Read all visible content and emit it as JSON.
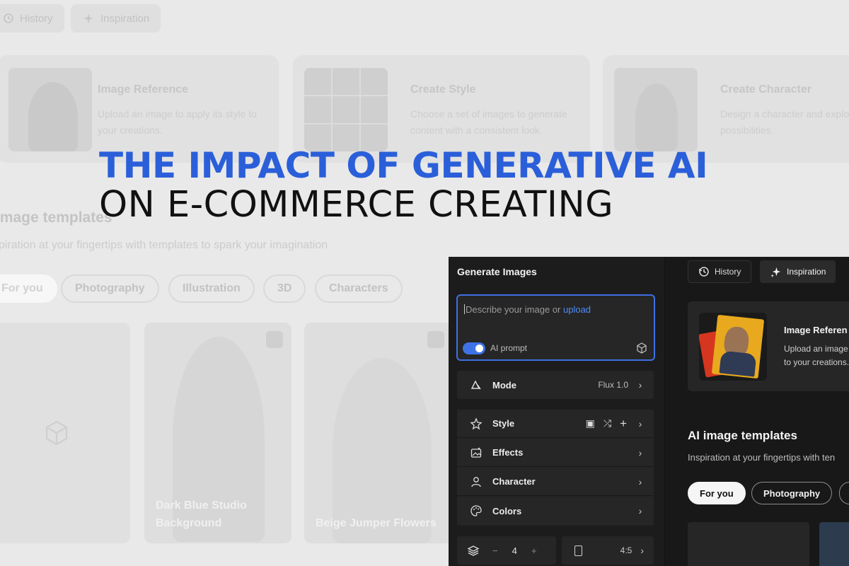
{
  "background": {
    "top_buttons": [
      {
        "icon": "history-icon",
        "label": "History"
      },
      {
        "icon": "sparkle-icon",
        "label": "Inspiration"
      }
    ],
    "cards": [
      {
        "title": "Image Reference",
        "desc": "Upload an image to apply its style to your creations."
      },
      {
        "title": "Create Style",
        "desc": "Choose a set of images to generate content with a consistent look."
      },
      {
        "title": "Create Character",
        "desc": "Design a character and explo possibilities."
      }
    ],
    "section_title": "image templates",
    "section_sub": "piration at your fingertips with templates to spark your imagination",
    "pills": [
      "For you",
      "Photography",
      "Illustration",
      "3D",
      "Characters"
    ],
    "tiles": [
      {
        "label": ""
      },
      {
        "label": "Dark Blue Studio Background"
      },
      {
        "label": "Beige Jumper Flowers"
      }
    ]
  },
  "headline": {
    "line1": "THE IMPACT OF GENERATIVE AI",
    "line2": "ON E-COMMERCE CREATING"
  },
  "app": {
    "panel_title": "Generate Images",
    "prompt": {
      "placeholder": "Describe your image or ",
      "upload_link": "upload",
      "ai_prompt_label": "AI prompt",
      "ai_prompt_on": true
    },
    "mode": {
      "label": "Mode",
      "value": "Flux 1.0"
    },
    "options": [
      {
        "icon": "style-icon",
        "label": "Style"
      },
      {
        "icon": "effects-icon",
        "label": "Effects"
      },
      {
        "icon": "character-icon",
        "label": "Character"
      },
      {
        "icon": "colors-icon",
        "label": "Colors"
      }
    ],
    "count": {
      "minus": "−",
      "value": "4",
      "plus": "+"
    },
    "ratio": "4:5",
    "top_buttons": [
      {
        "icon": "history-icon",
        "label": "History"
      },
      {
        "icon": "sparkle-icon",
        "label": "Inspiration"
      }
    ],
    "ref_card": {
      "title": "Image Referen",
      "desc_line1": "Upload an image",
      "desc_line2": "to your creations."
    },
    "templates_title": "AI image templates",
    "templates_sub": "Inspiration at your fingertips with ten",
    "pills": [
      "For you",
      "Photography"
    ],
    "colors": {
      "accent": "#3f6fe3",
      "headline_blue": "#2b5fd9",
      "panel_bg": "#1c1c1c"
    }
  }
}
